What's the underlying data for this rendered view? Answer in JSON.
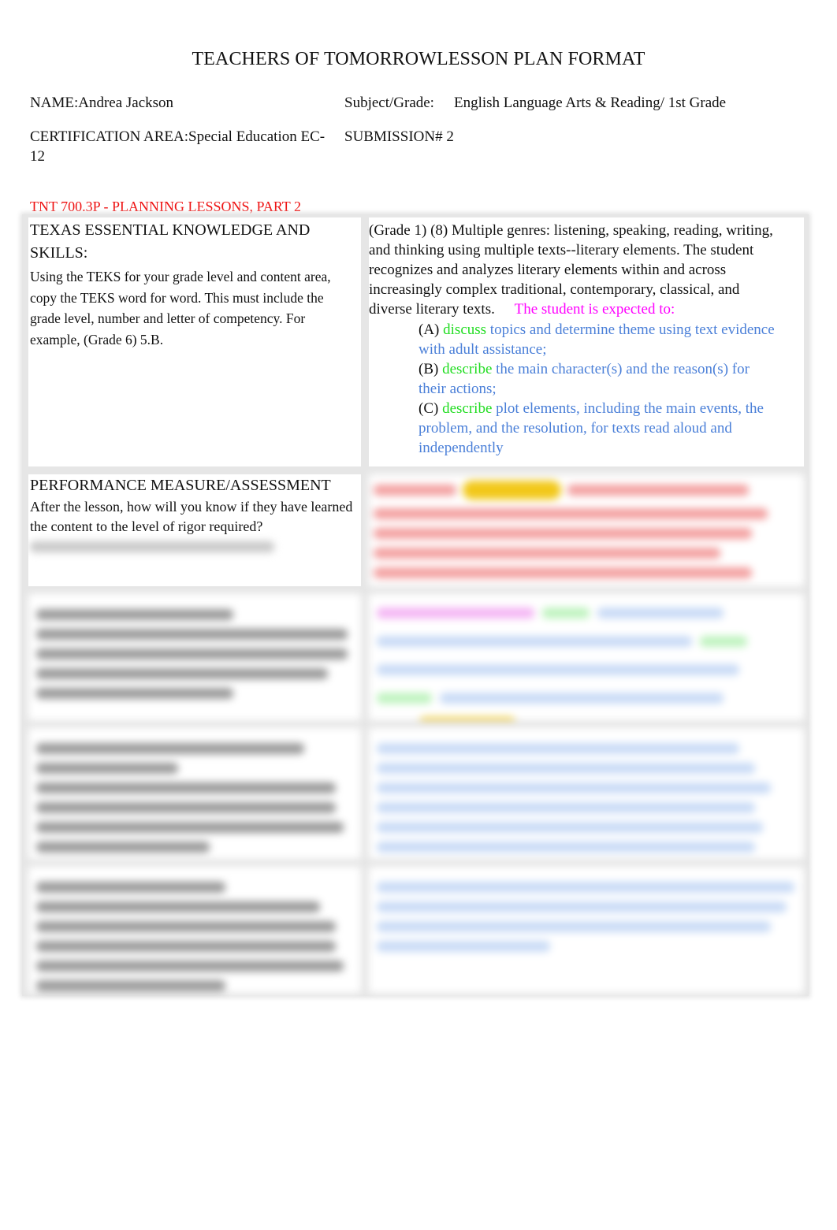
{
  "document": {
    "title": "TEACHERS OF TOMORROWLESSON PLAN FORMAT",
    "name_label": "NAME:",
    "name_value": "Andrea Jackson",
    "subject_label": "Subject/Grade:",
    "subject_value": "English Language Arts & Reading/ 1st Grade",
    "certification_label": "CERTIFICATION AREA:",
    "certification_value": "Special Education EC-12",
    "submission_label": "SUBMISSION#",
    "submission_value": "2",
    "section_label": "TNT 700.3P - PLANNING LESSONS, PART 2"
  },
  "table": {
    "teks": {
      "heading": "TEXAS ESSENTIAL KNOWLEDGE AND SKILLS:",
      "instructions": " Using the TEKS for your grade level and content area, copy the TEKS word for word. This must include the grade level, number and letter of competency. For example, (Grade 6) 5.B.",
      "standard_text": "(Grade 1) (8) Multiple genres: listening, speaking, reading, writing, and thinking using multiple texts--literary elements. The student recognizes and analyzes literary elements within and across increasingly complex traditional, contemporary, classical, and diverse literary texts.",
      "expectation_lead": "The student is expected to:",
      "items": [
        {
          "letter": "(A)",
          "verb": "discuss",
          "text": "topics and determine theme using text evidence with adult assistance;"
        },
        {
          "letter": "(B)",
          "verb": "describe",
          "text": "the main character(s) and the reason(s) for their actions;"
        },
        {
          "letter": "(C)",
          "verb": "describe",
          "text": "plot elements, including the main events, the problem, and the resolution, for texts read aloud and independently"
        }
      ]
    },
    "performance": {
      "heading": "PERFORMANCE MEASURE/ASSESSMENT",
      "instructions": "After the lesson, how will you know if they have learned the content to the level of rigor required?",
      "blurred": true
    },
    "blurred_rows": [
      {
        "name": "objective-row"
      },
      {
        "name": "essential-question-row"
      },
      {
        "name": "strategies-row"
      }
    ]
  },
  "colors": {
    "section_label": "#ee1111",
    "expectation": "#ff00ff",
    "verb": "#22dd22",
    "standard_item": "#4a7fd8",
    "highlight": "#f2c81a"
  }
}
